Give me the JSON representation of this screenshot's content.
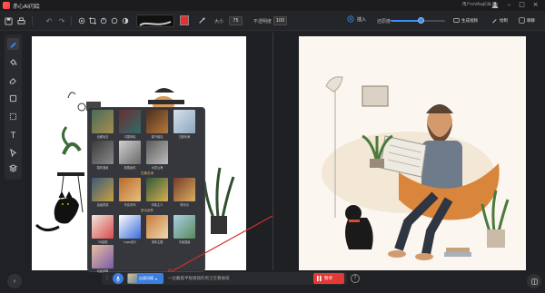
{
  "app": {
    "title": "赤心AI闪绘",
    "user": "用户mV6wJC8LDb"
  },
  "toolbar": {
    "size_label": "大小",
    "size_value": "75",
    "opacity_label": "不透明度",
    "opacity_value": "100",
    "brush_color": "#e53030"
  },
  "right_toolbar": {
    "import_label": "插入",
    "strength_label": "还原度",
    "strength_value": 0.55,
    "generate_label": "生成视频",
    "draw_label": "绘制",
    "share_label": "聊聊"
  },
  "popup": {
    "row1": [
      "全都玩法",
      "中国神兽",
      "蒸汽朋克",
      "古韵传承"
    ],
    "row2": [
      "国风漫画",
      "新国画风",
      "水墨山海"
    ],
    "section1": "古典艺术",
    "row3": [
      "油画质感",
      "写实系列",
      "印象主义",
      "现代派"
    ],
    "section2": "多元创作",
    "row4": [
      "3D建模",
      "Logo设计",
      "电商主图",
      "平面插画"
    ],
    "row5": [
      "动画风格"
    ]
  },
  "bottom": {
    "style_chip": "出观风格",
    "prompt": "一位戴着半框眼镜的男士在看报纸",
    "stop_label": "暂停",
    "help": "?"
  },
  "colors": {
    "accent": "#3a8ef6",
    "stop": "#e53935",
    "chip": "#3a7ee0"
  }
}
